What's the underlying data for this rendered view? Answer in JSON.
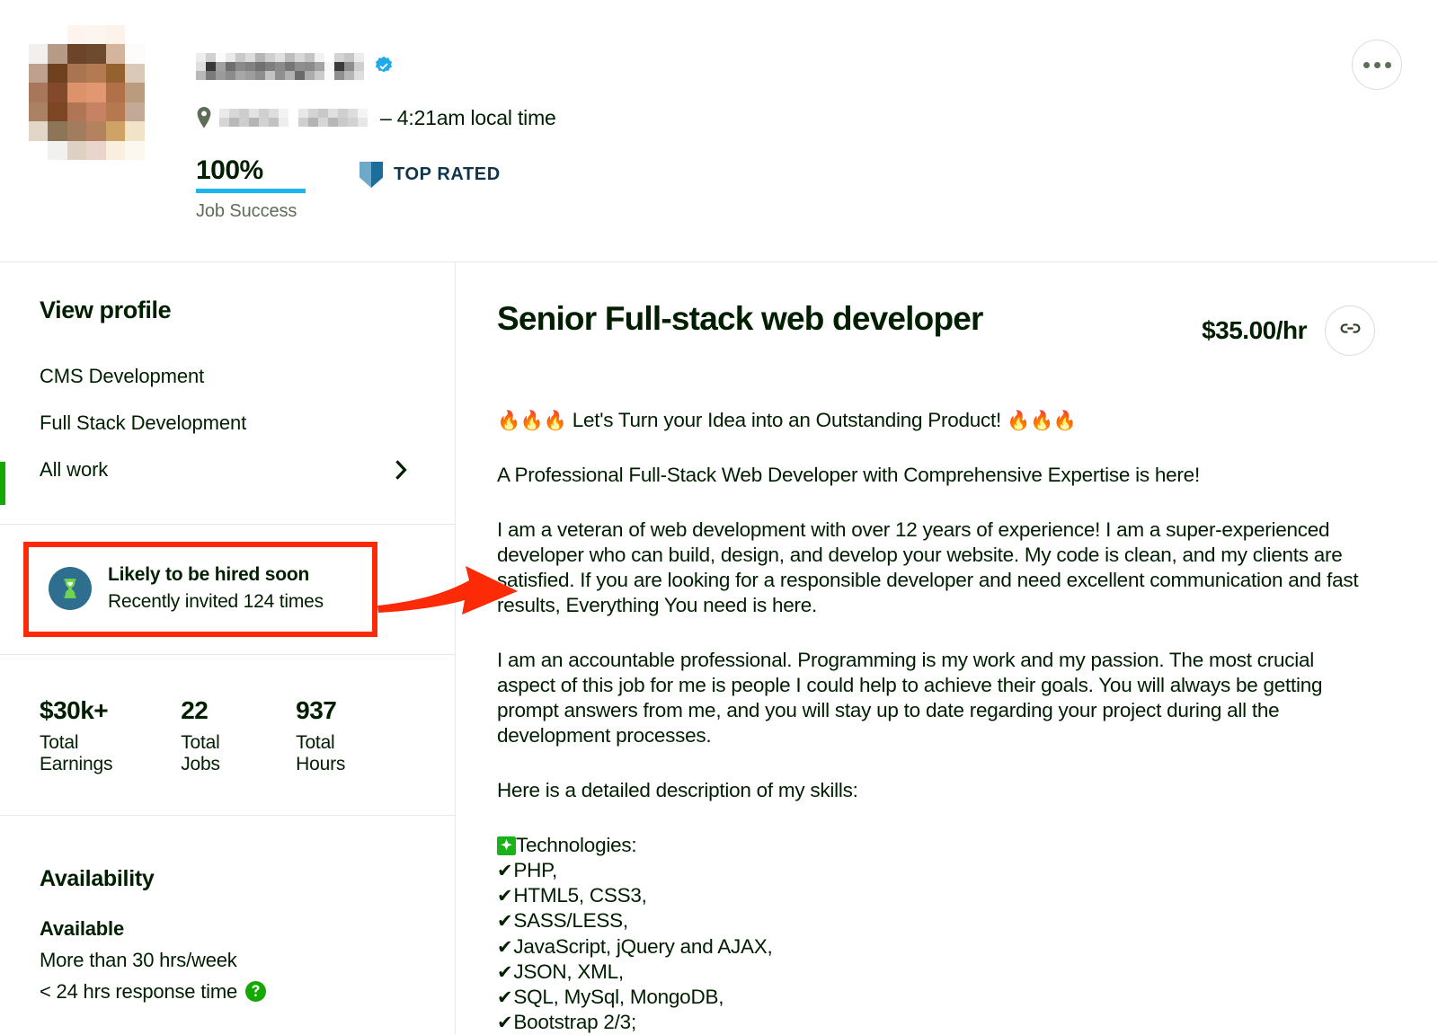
{
  "header": {
    "avatar": {
      "icon": "profile-photo-pixelated",
      "redacted": true
    },
    "name_redacted": true,
    "verified_icon": "verified-badge-icon",
    "location_icon": "map-pin-icon",
    "location_redacted": true,
    "local_time": "– 4:21am local time",
    "job_success_percent": "100%",
    "job_success_label": "Job Success",
    "top_rated_label": "TOP RATED",
    "top_rated_icon": "shield-icon",
    "more_button_icon": "ellipsis-icon",
    "accent_color": "#1bb5ef",
    "badge_color": "#10354b"
  },
  "sidebar": {
    "title": "View profile",
    "items": [
      {
        "label": "CMS Development",
        "active": false,
        "chevron": false
      },
      {
        "label": "Full Stack Development",
        "active": false,
        "chevron": false
      },
      {
        "label": "All work",
        "active": true,
        "chevron": true
      }
    ],
    "active_bar_color": "#14a800",
    "hire_badge": {
      "icon": "hourglass-icon",
      "title": "Likely to be hired soon",
      "subtitle": "Recently invited 124 times",
      "highlight_color": "#fc2a06",
      "circle_color": "#2e6e8e",
      "glyph_color": "#6fd44e"
    },
    "stats": [
      {
        "value": "$30k+",
        "label": "Total Earnings"
      },
      {
        "value": "22",
        "label": "Total Jobs"
      },
      {
        "value": "937",
        "label": "Total Hours"
      }
    ],
    "availability": {
      "title": "Availability",
      "status": "Available",
      "hours": "More than 30 hrs/week",
      "response": "< 24 hrs response time",
      "help_icon": "help-circle-icon",
      "help_color": "#14a800"
    }
  },
  "main": {
    "job_title": "Senior Full-stack web developer",
    "rate": "$35.00/hr",
    "link_button_icon": "link-icon",
    "overview": {
      "headline_emoji_left": "🔥🔥🔥",
      "headline": "Let's Turn your Idea into an Outstanding Product!",
      "headline_emoji_right": "🔥🔥🔥",
      "paragraphs": [
        "A Professional Full-Stack Web Developer with Comprehensive Expertise is here!",
        "I am a veteran of web development with over 12 years of experience! I am a super-experienced developer who can build, design, and develop your website. My code is clean, and my clients are satisfied. If you are looking for a responsible developer and need excellent communication and fast results, Everything You need is here.",
        "I am an accountable professional. Programming is my work and my passion. The most crucial aspect of this job for me is people I could help to achieve their goals. You will always be getting prompt answers from me, and you will stay up to date regarding your project during all the development processes.",
        "Here is a detailed description of my skills:"
      ],
      "tech_heading": "Technologies:",
      "tech_icon": "sparkle-green-icon",
      "tech_items": [
        "PHP,",
        "HTML5, CSS3,",
        "SASS/LESS,",
        "JavaScript, jQuery and AJAX,",
        "JSON, XML,",
        "SQL, MySql, MongoDB,",
        "Bootstrap 2/3;"
      ],
      "check_glyph": "✔"
    }
  },
  "annotation": {
    "arrow_icon": "red-arrow-icon",
    "color": "#fc2a06"
  }
}
